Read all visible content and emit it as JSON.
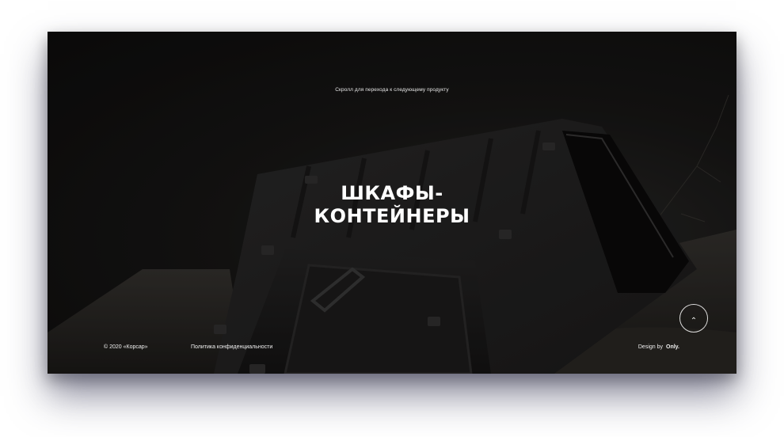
{
  "hero": {
    "scroll_hint": "Скролл для перехода к следующему продукту",
    "title_line1": "ШКАФЫ-",
    "title_line2": "КОНТЕЙНЕРЫ"
  },
  "footer": {
    "copyright": "© 2020 «Корсар»",
    "privacy_link": "Политика конфиденциальности",
    "design_by_label": "Design by",
    "design_brand": "Only."
  },
  "icons": {
    "scroll_up": "chevron-up-icon"
  },
  "colors": {
    "background": "#141312",
    "text": "#ffffff",
    "page": "#ffffff"
  }
}
